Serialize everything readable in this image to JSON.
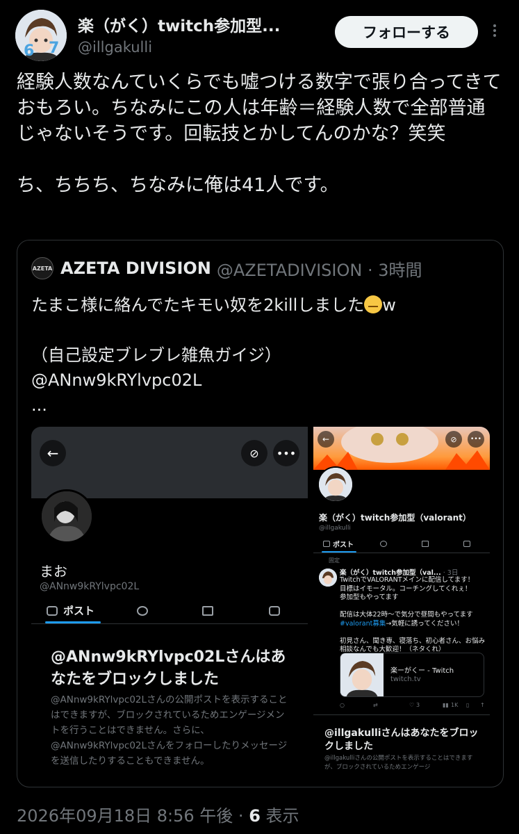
{
  "author": {
    "display_name": "楽（がく）twitch参加型...",
    "handle": "@illgakulli",
    "follow_label": "フォローする"
  },
  "tweet": {
    "text_1": "経験人数なんていくらでも嘘つける数字で張り合ってきておもろい。ちなみにこの人は年齢＝経験人数で全部普通じゃないそうです。回転技とかしてんのかな？笑笑",
    "text_2": "ち、ちちち、ちなみに俺は41人です。"
  },
  "quote": {
    "logo_text": "AZETA",
    "name": "AZETA DIVISION",
    "meta": "@AZETADIVISION · 3時間",
    "line_1a": "たまこ様に絡んでたキモい奴を2killしました",
    "line_1b": "w",
    "line_2": "（自己設定ブレブレ雑魚ガイジ）",
    "line_3": "@ANnw9kRYlvpc02L",
    "line_4": "..."
  },
  "screenshot_left": {
    "name": "まお",
    "handle": "@ANnw9kRYlvpc02L",
    "tab_posts": "ポスト",
    "block_title": "@ANnw9kRYlvpc02Lさんはあなたをブロックしました",
    "block_desc": "@ANnw9kRYlvpc02Lさんの公開ポストを表示することはできますが、ブロックされているためエンゲージメントを行うことはできません。さらに、@ANnw9kRYlvpc02Lさんをフォローしたりメッセージを送信したりすることもできません。"
  },
  "screenshot_right": {
    "name": "楽（がく）twitch参加型（valorant）",
    "handle": "@illgakulli",
    "tab_posts": "ポスト",
    "pinned": "固定",
    "post_head_name": "楽（がく）twitch参加型（val...",
    "post_head_meta": "· 3日",
    "post_line_1": "TwitchでVALORANTメインに配信してます！",
    "post_line_2": "目標はイモータル。コーチングしてくれぇ！",
    "post_line_3": "参加型もやってます",
    "post_line_4": "配信は大体22時〜で気分で昼間もやってます",
    "post_hashtag": "#valorant募集",
    "post_line_5": "→気軽に誘ってください！",
    "post_line_6": "初見さん、聞き専、寝落ち、初心者さん、お悩み相談なんでも大歓迎！（ネタくれ）",
    "card_title": "楽ーがくー - Twitch",
    "card_domain": "twitch.tv",
    "likes": "3",
    "views": "1K",
    "block_title": "@illgakulliさんはあなたをブロックしました",
    "block_desc": "@illgakulliさんの公開ポストを表示することはできますが、ブロックされているためエンゲージ"
  },
  "footer": {
    "datetime": "2026年09月18日 8:56 午後 · ",
    "views_count": "6",
    "views_label": " 表示"
  },
  "colors": {
    "background": "#000000",
    "text_primary": "#e7e9ea",
    "text_secondary": "#71767b",
    "accent": "#1d9bf0",
    "follow_bg": "#eff3f4",
    "border": "#2f3336"
  }
}
